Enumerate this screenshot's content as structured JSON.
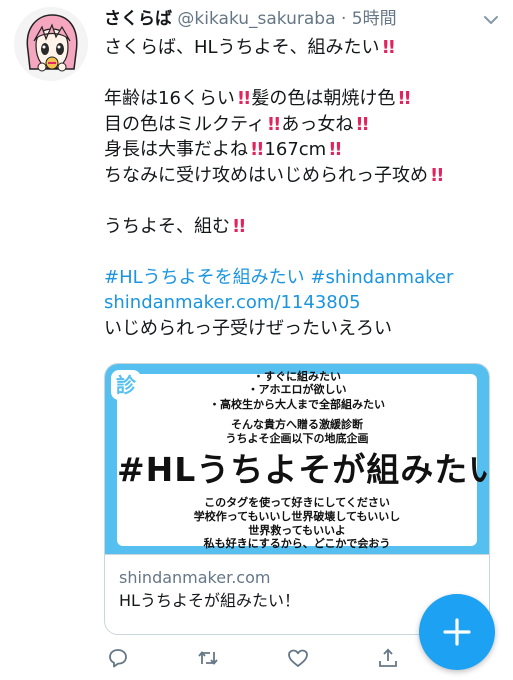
{
  "tweet": {
    "display_name": "さくらば",
    "handle": "@kikaku_sakuraba",
    "separator": "·",
    "time": "5時間",
    "lines": {
      "l1": "さくらば、HLうちよそ、組みたい",
      "l2a": "年齢は16くらい",
      "l2b": "髪の色は朝焼け色",
      "l3a": "目の色はミルクティ",
      "l3b": "あっ女ね",
      "l4a": "身長は大事だよね",
      "l4b": "167cm",
      "l5": "ちなみに受け攻めはいじめられっ子攻め",
      "l6": "うちよそ、組む",
      "hashtag1": "#HLうちよそを組みたい",
      "hashtag2": "#shindanmaker",
      "url": "shindanmaker.com/1143805",
      "l9": "いじめられっ子受けぜったいえろい"
    },
    "bang": "!!"
  },
  "card": {
    "badge": "診",
    "image_lines": {
      "t0": "・すぐに組みたい",
      "t1": "・アホエロが欲しい",
      "t2": "・高校生から大人まで全部組みたい",
      "t3": "そんな貴方へ贈る激緩診断",
      "t4": "うちよそ企画以下の地底企画",
      "big": "#HLうちよそが組みたい",
      "t5": "このタグを使って好きにしてください",
      "t6": "学校作ってもいいし世界破壊してもいいし",
      "t7": "世界救ってもいいよ",
      "t8": "私も好きにするから、どこかで会おう"
    },
    "domain": "shindanmaker.com",
    "title": "HLうちよそが組みたい！"
  },
  "colors": {
    "accent": "#1da1f2",
    "link": "#1b95e0",
    "bang": "#e0245e",
    "card_bg": "#55c0f0"
  },
  "icons": {
    "reply": "reply-icon",
    "retweet": "retweet-icon",
    "like": "heart-icon",
    "share": "share-icon",
    "compose": "compose-plus-icon",
    "caret": "chevron-down-icon"
  }
}
